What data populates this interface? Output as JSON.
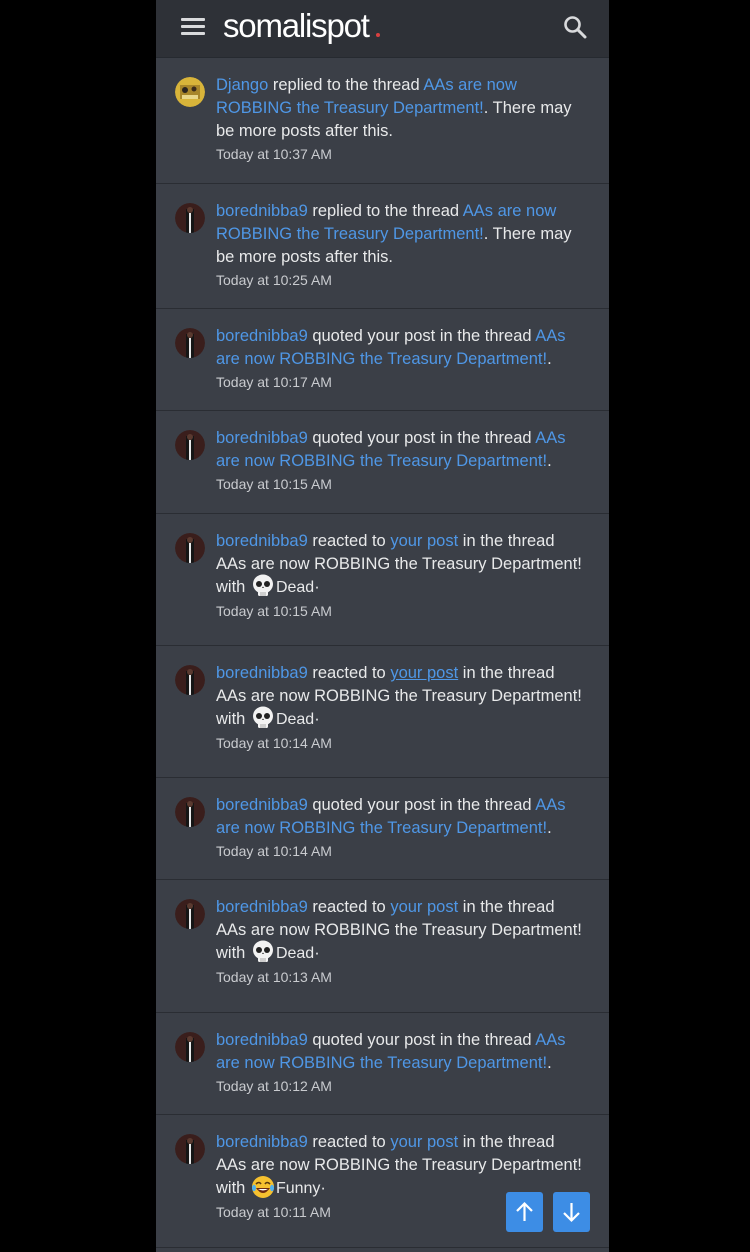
{
  "header": {
    "logo": "somalispot",
    "menu_icon": "hamburger-menu-icon",
    "search_icon": "search-icon",
    "logo_accent_color": "#d94040"
  },
  "colors": {
    "link": "#4f97e6",
    "background": "#3b3f47",
    "fab": "#3d8de5"
  },
  "alerts": [
    {
      "user": "Django",
      "action": " replied to the thread ",
      "thread": "AAs are now ROBBING the Treasury Department!",
      "suffix": ". There may be more posts after this.",
      "time": "Today at 10:37 AM"
    },
    {
      "user": "borednibba9",
      "action": " replied to the thread ",
      "thread": "AAs are now ROBBING the Treasury Department!",
      "suffix": ". There may be more posts after this.",
      "time": "Today at 10:25 AM"
    },
    {
      "user": "borednibba9",
      "action": " quoted your post in the thread ",
      "thread": "AAs are now ROBBING the Treasury Department!",
      "suffix": ".",
      "time": "Today at 10:17 AM"
    },
    {
      "user": "borednibba9",
      "action": " quoted your post in the thread ",
      "thread": "AAs are now ROBBING the Treasury Department!",
      "suffix": ".",
      "time": "Today at 10:15 AM"
    },
    {
      "user": "borednibba9",
      "action": " reacted to ",
      "post_link": "your post",
      "mid": " in the thread AAs are now ROBBING the Treasury Department! with ",
      "reaction": "Dead",
      "reaction_icon": "skull-emoji-icon",
      "end": "·",
      "time": "Today at 10:15 AM"
    },
    {
      "user": "borednibba9",
      "action": " reacted to ",
      "post_link": "your post",
      "mid": " in the thread AAs are now ROBBING the Treasury Department! with ",
      "reaction": "Dead",
      "reaction_icon": "skull-emoji-icon",
      "end": "·",
      "time": "Today at 10:14 AM"
    },
    {
      "user": "borednibba9",
      "action": " quoted your post in the thread ",
      "thread": "AAs are now ROBBING the Treasury Department!",
      "suffix": ".",
      "time": "Today at 10:14 AM"
    },
    {
      "user": "borednibba9",
      "action": " reacted to ",
      "post_link": "your post",
      "mid": " in the thread AAs are now ROBBING the Treasury Department! with ",
      "reaction": "Dead",
      "reaction_icon": "skull-emoji-icon",
      "end": "·",
      "time": "Today at 10:13 AM"
    },
    {
      "user": "borednibba9",
      "action": " quoted your post in the thread ",
      "thread": "AAs are now ROBBING the Treasury Department!",
      "suffix": ".",
      "time": "Today at 10:12 AM"
    },
    {
      "user": "borednibba9",
      "action": " reacted to ",
      "post_link": "your post",
      "mid": " in the thread AAs are now ROBBING the Treasury Department! with ",
      "reaction": "Funny",
      "reaction_icon": "laughing-emoji-icon",
      "end": "·",
      "time": "Today at 10:11 AM"
    }
  ],
  "fabs": {
    "up_icon": "arrow-up-icon",
    "down_icon": "arrow-down-icon"
  }
}
